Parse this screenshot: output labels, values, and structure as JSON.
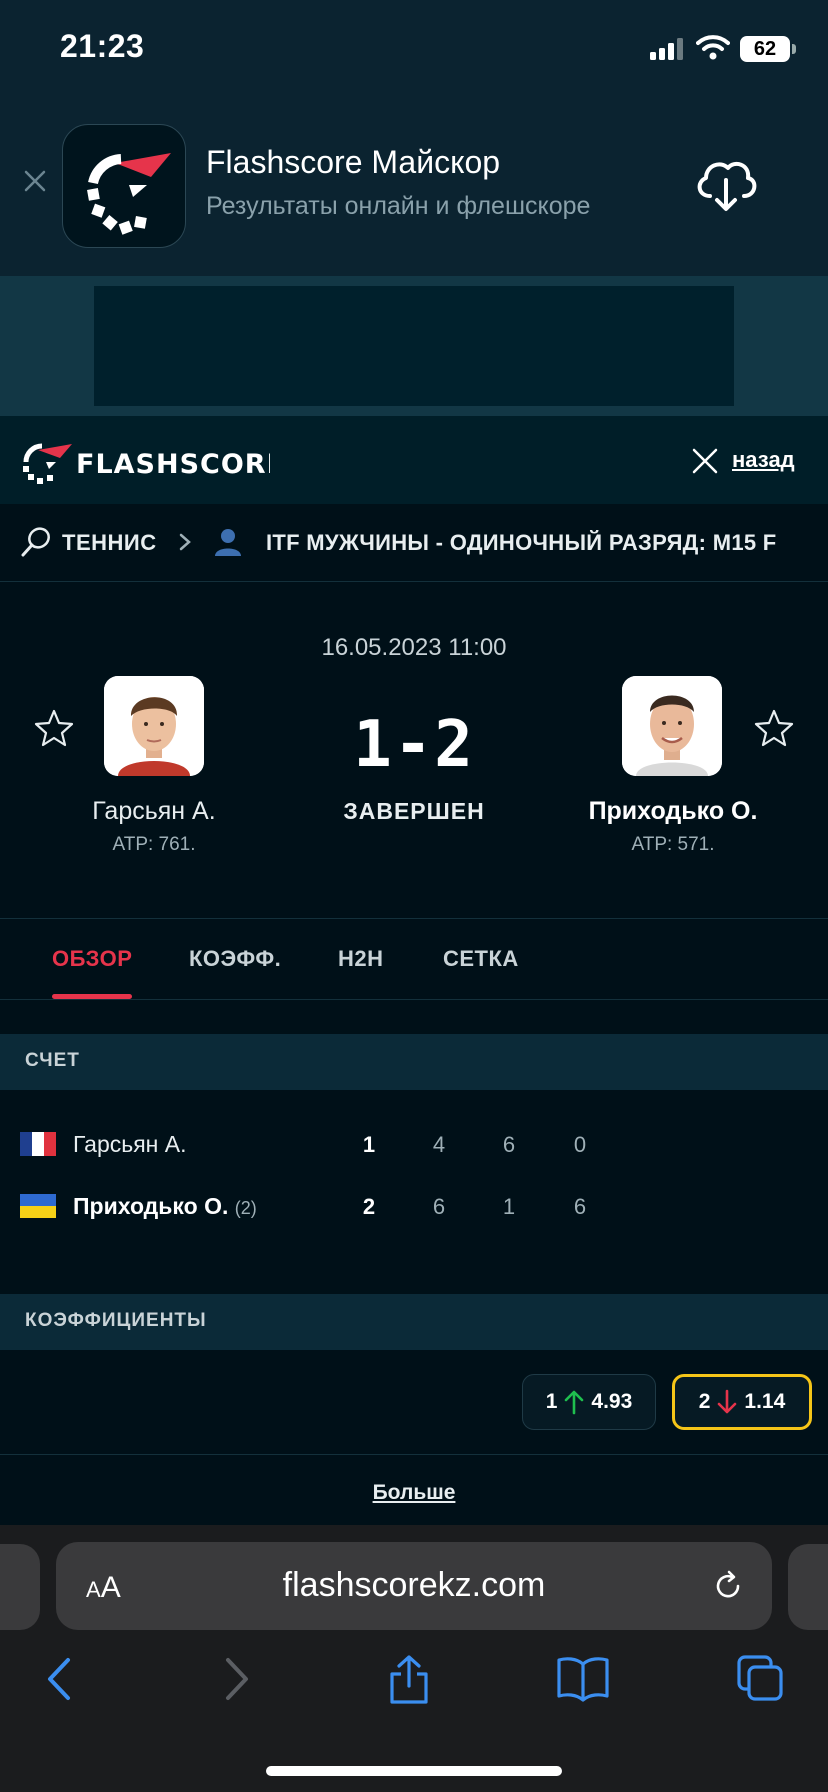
{
  "status_bar": {
    "time": "21:23",
    "battery": "62"
  },
  "smart_banner": {
    "title": "Flashscore Майскор",
    "subtitle": "Результаты онлайн и флешскоре"
  },
  "header": {
    "logo_text": "FLASHSCORE",
    "back_label": "назад"
  },
  "breadcrumb": {
    "sport": "ТЕННИС",
    "league": "ITF МУЖЧИНЫ - ОДИНОЧНЫЙ РАЗРЯД: M15 F"
  },
  "match": {
    "datetime": "16.05.2023 11:00",
    "score": "1-2",
    "status": "ЗАВЕРШЕН",
    "home": {
      "name": "Гарсьян А.",
      "rank": "ATP: 761."
    },
    "away": {
      "name": "Приходько О.",
      "rank": "ATP: 571."
    }
  },
  "tabs": [
    {
      "label": "ОБЗОР",
      "active": true
    },
    {
      "label": "КОЭФФ.",
      "active": false
    },
    {
      "label": "H2H",
      "active": false
    },
    {
      "label": "СЕТКА",
      "active": false
    }
  ],
  "score_section": {
    "title": "СЧЕТ",
    "rows": [
      {
        "name": "Гарсьян А.",
        "seed": "",
        "flag": "france",
        "total": "1",
        "sets": [
          "4",
          "6",
          "0"
        ]
      },
      {
        "name": "Приходько О.",
        "seed": "(2)",
        "flag": "ukraine",
        "total": "2",
        "sets": [
          "6",
          "1",
          "6"
        ]
      }
    ]
  },
  "odds_section": {
    "title": "КОЭФФИЦИЕНТЫ",
    "home": {
      "label": "1",
      "value": "4.93",
      "trend": "up"
    },
    "away": {
      "label": "2",
      "value": "1.14",
      "trend": "down"
    },
    "more_label": "Больше"
  },
  "browser": {
    "text_size_label": "AA",
    "url": "flashscorekz.com"
  },
  "colors": {
    "accent": "#e6344b",
    "highlight": "#f5c518",
    "trend_up": "#1fbf4f",
    "trend_down": "#e6344b",
    "link_blue": "#3b8ef0"
  }
}
